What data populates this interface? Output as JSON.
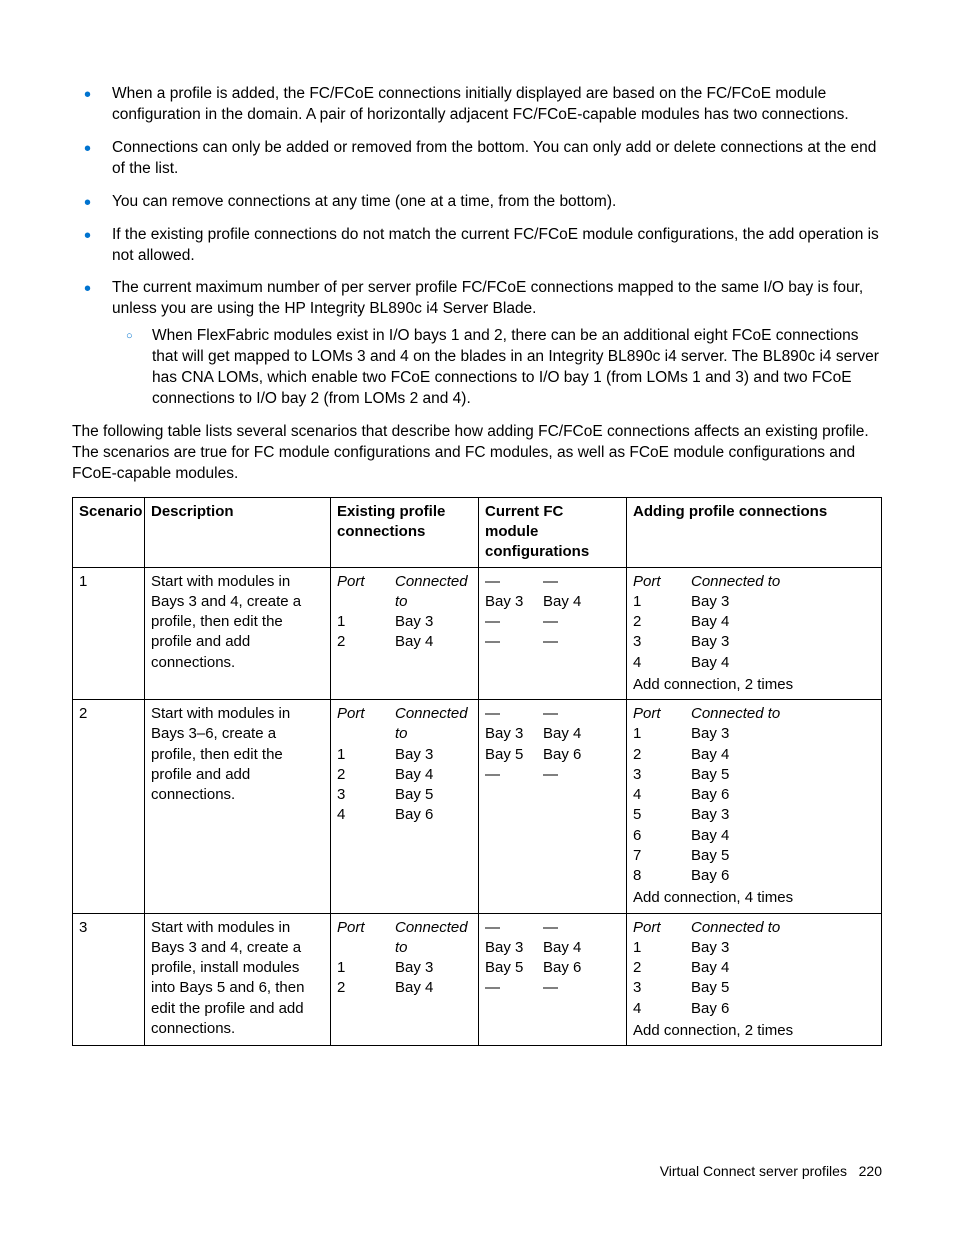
{
  "bullets": [
    {
      "text": "When a profile is added, the FC/FCoE connections initially displayed are based on the FC/FCoE module configuration in the domain. A pair of horizontally adjacent FC/FCoE-capable modules has two connections."
    },
    {
      "text": "Connections can only be added or removed from the bottom. You can only add or delete connections at the end of the list."
    },
    {
      "text": "You can remove connections at any time (one at a time, from the bottom)."
    },
    {
      "text": "If the existing profile connections do not match the current FC/FCoE module configurations, the add operation is not allowed."
    },
    {
      "text": "The current maximum number of per server profile FC/FCoE connections mapped to the same I/O bay is four, unless you are using the HP Integrity BL890c i4 Server Blade.",
      "sub": [
        "When FlexFabric modules exist in I/O bays 1 and 2, there can be an additional eight FCoE connections that will get mapped to LOMs 3 and 4 on the blades in an Integrity BL890c i4 server. The BL890c i4 server has CNA LOMs, which enable two FCoE connections to I/O bay 1 (from LOMs 1 and 3) and two FCoE connections to I/O bay 2 (from LOMs 2 and 4)."
      ]
    }
  ],
  "lead": "The following table lists several scenarios that describe how adding FC/FCoE connections affects an existing profile. The scenarios are true for FC module configurations and FC modules, as well as FCoE module configurations and FCoE-capable modules.",
  "headers": {
    "c1": "Scenario",
    "c2": "Description",
    "c3": "Existing profile connections",
    "c4": "Current FC module configurations",
    "c5": "Adding profile connections",
    "port": "Port",
    "conn": "Connected to"
  },
  "rows": [
    {
      "scenario": "1",
      "desc": "Start with modules in Bays 3 and 4, create a profile, then edit the profile and add connections.",
      "existing": [
        [
          "1",
          "Bay 3"
        ],
        [
          "2",
          "Bay 4"
        ]
      ],
      "current": [
        [
          "—",
          "—"
        ],
        [
          "Bay 3",
          "Bay 4"
        ],
        [
          "—",
          "—"
        ],
        [
          "—",
          "—"
        ]
      ],
      "adding": [
        [
          "1",
          "Bay 3"
        ],
        [
          "2",
          "Bay 4"
        ],
        [
          "3",
          "Bay 3"
        ],
        [
          "4",
          "Bay 4"
        ]
      ],
      "note": "Add connection, 2 times"
    },
    {
      "scenario": "2",
      "desc": "Start with modules in Bays 3–6, create a profile, then edit the profile and add connections.",
      "existing": [
        [
          "1",
          "Bay 3"
        ],
        [
          "2",
          "Bay 4"
        ],
        [
          "3",
          "Bay 5"
        ],
        [
          "4",
          "Bay 6"
        ]
      ],
      "current": [
        [
          "—",
          "—"
        ],
        [
          "Bay 3",
          "Bay 4"
        ],
        [
          "Bay 5",
          "Bay 6"
        ],
        [
          "—",
          "—"
        ]
      ],
      "adding": [
        [
          "1",
          "Bay 3"
        ],
        [
          "2",
          "Bay 4"
        ],
        [
          "3",
          "Bay 5"
        ],
        [
          "4",
          "Bay 6"
        ],
        [
          "5",
          "Bay 3"
        ],
        [
          "6",
          "Bay 4"
        ],
        [
          "7",
          "Bay 5"
        ],
        [
          "8",
          "Bay 6"
        ]
      ],
      "note": "Add connection, 4 times"
    },
    {
      "scenario": "3",
      "desc": "Start with modules in Bays 3 and 4, create a profile, install modules into Bays 5 and 6, then edit the profile and add connections.",
      "existing": [
        [
          "1",
          "Bay 3"
        ],
        [
          "2",
          "Bay 4"
        ]
      ],
      "current": [
        [
          "—",
          "—"
        ],
        [
          "Bay 3",
          "Bay 4"
        ],
        [
          "Bay 5",
          "Bay 6"
        ],
        [
          "—",
          "—"
        ]
      ],
      "adding": [
        [
          "1",
          "Bay 3"
        ],
        [
          "2",
          "Bay 4"
        ],
        [
          "3",
          "Bay 5"
        ],
        [
          "4",
          "Bay 6"
        ]
      ],
      "note": "Add connection, 2 times"
    }
  ],
  "footer": {
    "section": "Virtual Connect server profiles",
    "page": "220"
  }
}
